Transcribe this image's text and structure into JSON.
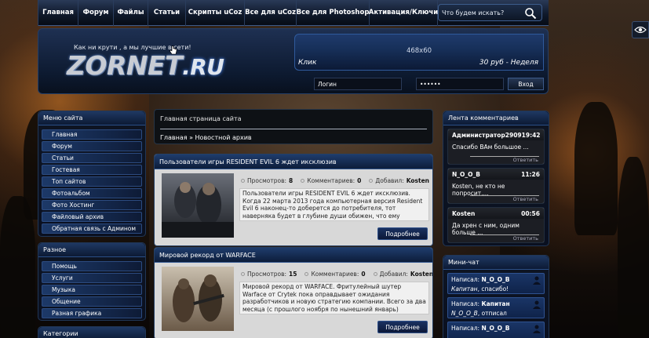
{
  "nav": {
    "items": [
      "Главная",
      "Форум",
      "Файлы",
      "Статьи",
      "Скрипты uCoz",
      "Все для uCoz",
      "Все для Photoshop",
      "Активация/Ключи"
    ],
    "search_placeholder": "Что будем искать?"
  },
  "header": {
    "slogan": "Как ни крути , а мы лучшие в сети!",
    "logo_main": "ZORNET",
    "logo_suffix": ".RU",
    "ad": {
      "size": "468x60",
      "left": "Клик",
      "right": "30 руб - Неделя"
    },
    "login_placeholder": "Логин",
    "password_value": "••••••",
    "login_button": "Вход"
  },
  "sidebar_menu": {
    "title": "Меню сайта",
    "items": [
      "Главная",
      "Форум",
      "Статьи",
      "Гостевая",
      "Топ сайтов",
      "Фотоальбом",
      "Фото Хостинг",
      "Файловый архив",
      "Обратная связь с Админом"
    ]
  },
  "sidebar_misc": {
    "title": "Разное",
    "items": [
      "Помощь",
      "Услуги",
      "Музыка",
      "Общение",
      "Разная графика"
    ]
  },
  "sidebar_categories": {
    "title": "Категории"
  },
  "breadcrumb": {
    "title": "Главная страница сайта",
    "path": "Главная » Новостной архив"
  },
  "news": [
    {
      "title": "Пользователи игры RESIDENT EVIL 6 ждет иксклюзив",
      "views_label": "Просмотров:",
      "views": "8",
      "comments_label": "Комментариев:",
      "comments": "0",
      "author_label": "Добавил:",
      "author": "Kosten",
      "text": "Пользователи игры RESIDENT EVIL 6 ждет иксклюзив. Когда 22 марта 2013 года компьютерная версия Resident Evil 6 наконец-то доберется до потребителя, тот наверняка будет в глубине души обижен, что ему пришлось ждать на пять месяцев дольше, чем владельцам ... Читать дальше »",
      "more": "Подробнее"
    },
    {
      "title": "Мировой рекорд от WARFACE",
      "views_label": "Просмотров:",
      "views": "15",
      "comments_label": "Комментариев:",
      "comments": "0",
      "author_label": "Добавил:",
      "author": "Kosten",
      "text": "Мировой рекорд от WARFACE. Фритулейный шутер Warface от Crytek пока оправдывает ожидания разработчиков и новую стратегию компании. Всего за два месяца (с прошлого ноября по нынешний январь) количество зарегистрированных пользователей игры подскочило с ... Читать дальше »",
      "more": "Подробнее"
    }
  ],
  "comments_panel": {
    "title": "Лента комментариев",
    "items": [
      {
        "author": "Администратор2909",
        "time": "19:42",
        "text": "Спасибо ВАм большое ...",
        "reply": "Ответить"
      },
      {
        "author": "N_O_O_B",
        "time": "11:26",
        "text": "Kosten, не кто не попросит....",
        "reply": "Ответить"
      },
      {
        "author": "Kosten",
        "time": "00:56",
        "text": "Да хрен с ним, одним больше ...",
        "reply": "Ответить"
      }
    ]
  },
  "chat": {
    "title": "Мини-чат",
    "items": [
      {
        "label": "Написал:",
        "author": "N_O_O_B",
        "msg_name": "Капитан",
        "msg": ", спасибо!"
      },
      {
        "label": "Написал:",
        "author": "Капитан",
        "msg_name": "N_O_O_B",
        "msg": ", отписал"
      },
      {
        "label": "Написал:",
        "author": "N_O_O_B",
        "msg_name": "",
        "msg": ""
      }
    ]
  },
  "colors": {
    "accent": "#1d3968",
    "nav_bg": "#101a2c",
    "content_bg": "#d8d8d8"
  }
}
